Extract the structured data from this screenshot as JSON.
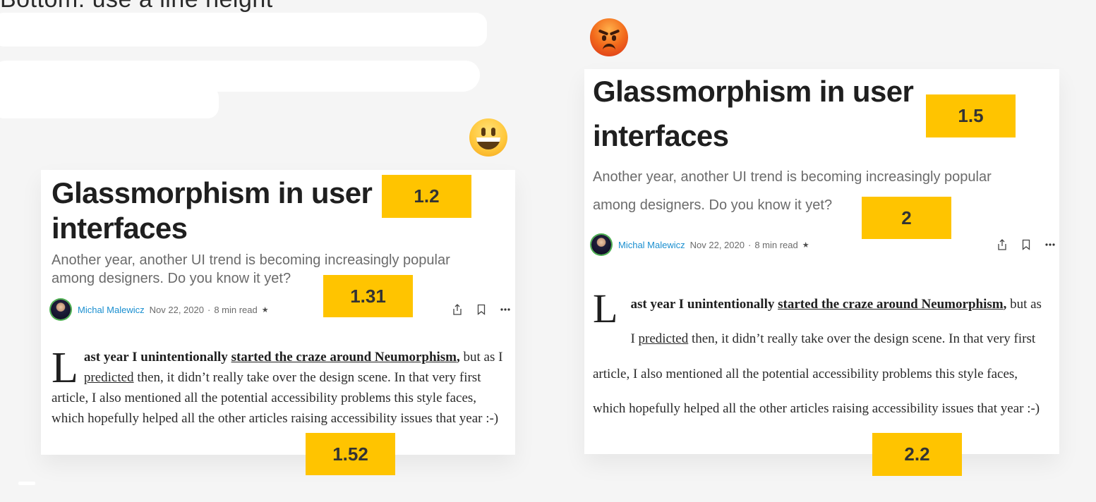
{
  "top_heading": "Bottom: use a line height",
  "emojis": {
    "left": "grinning-face-emoji",
    "right": "pouting-face-emoji"
  },
  "article": {
    "title": "Glassmorphism in user interfaces",
    "subtitle": "Another year, another UI trend is becoming increasingly popular among designers. Do you know it yet?",
    "author": "Michal Malewicz",
    "date": "Nov 22, 2020",
    "separator": "·",
    "read_time": "8 min read",
    "star": "★",
    "icons": [
      "share-icon",
      "bookmark-icon",
      "more-icon"
    ],
    "dropcap": "L",
    "lead": "ast year I unintentionally ",
    "lead_link": "started the craze around Neumorphism",
    "lead_end": ",",
    "body_1": " but as I ",
    "body_link": "predicted",
    "body_2": " then, it didn’t really take over the design scene. In that very first article, I also mentioned all the potential accessibility problems this style faces, which hopefully helped all the other articles raising accessibility issues that year :-)"
  },
  "annotations": {
    "left_title": "1.2",
    "left_subtitle": "1.31",
    "left_body": "1.52",
    "right_title": "1.5",
    "right_subtitle": "2",
    "right_body": "2.2"
  },
  "colors": {
    "badge": "#ffc400",
    "author_link": "#1a8fd0",
    "background": "#f5f5f5"
  }
}
